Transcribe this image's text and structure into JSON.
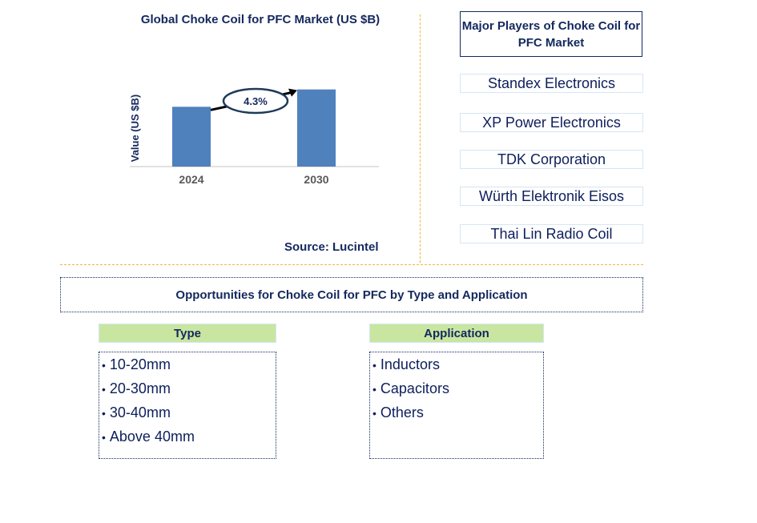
{
  "chart_data": {
    "type": "bar",
    "title": "Global Choke Coil for PFC Market (US $B)",
    "xlabel": "",
    "ylabel": "Value (US $B)",
    "categories": [
      "2024",
      "2030"
    ],
    "values": [
      1.0,
      1.29
    ],
    "value_note": "relative bar heights (no y-axis ticks shown)",
    "ylim": [
      0,
      1.5
    ],
    "grid": false,
    "annotation": {
      "label": "4.3%",
      "meaning": "CAGR 2024-2030",
      "from": "2024",
      "to": "2030"
    },
    "colors": {
      "bar": "#4f81bd",
      "text": "#13285e",
      "tick": "#595959",
      "axis": "#d9d9d9"
    }
  },
  "source": "Source: Lucintel",
  "players": {
    "title": "Major Players of Choke Coil for PFC Market",
    "items": [
      "Standex Electronics",
      "XP Power Electronics",
      "TDK Corporation",
      "Würth Elektronik Eisos",
      "Thai Lin Radio Coil"
    ]
  },
  "opportunities": {
    "title": "Opportunities for Choke Coil for PFC by Type and Application",
    "segments": [
      {
        "header": "Type",
        "items": [
          "10-20mm",
          "20-30mm",
          "30-40mm",
          "Above 40mm"
        ]
      },
      {
        "header": "Application",
        "items": [
          "Inductors",
          "Capacitors",
          "Others"
        ]
      }
    ]
  },
  "bullet": "•"
}
